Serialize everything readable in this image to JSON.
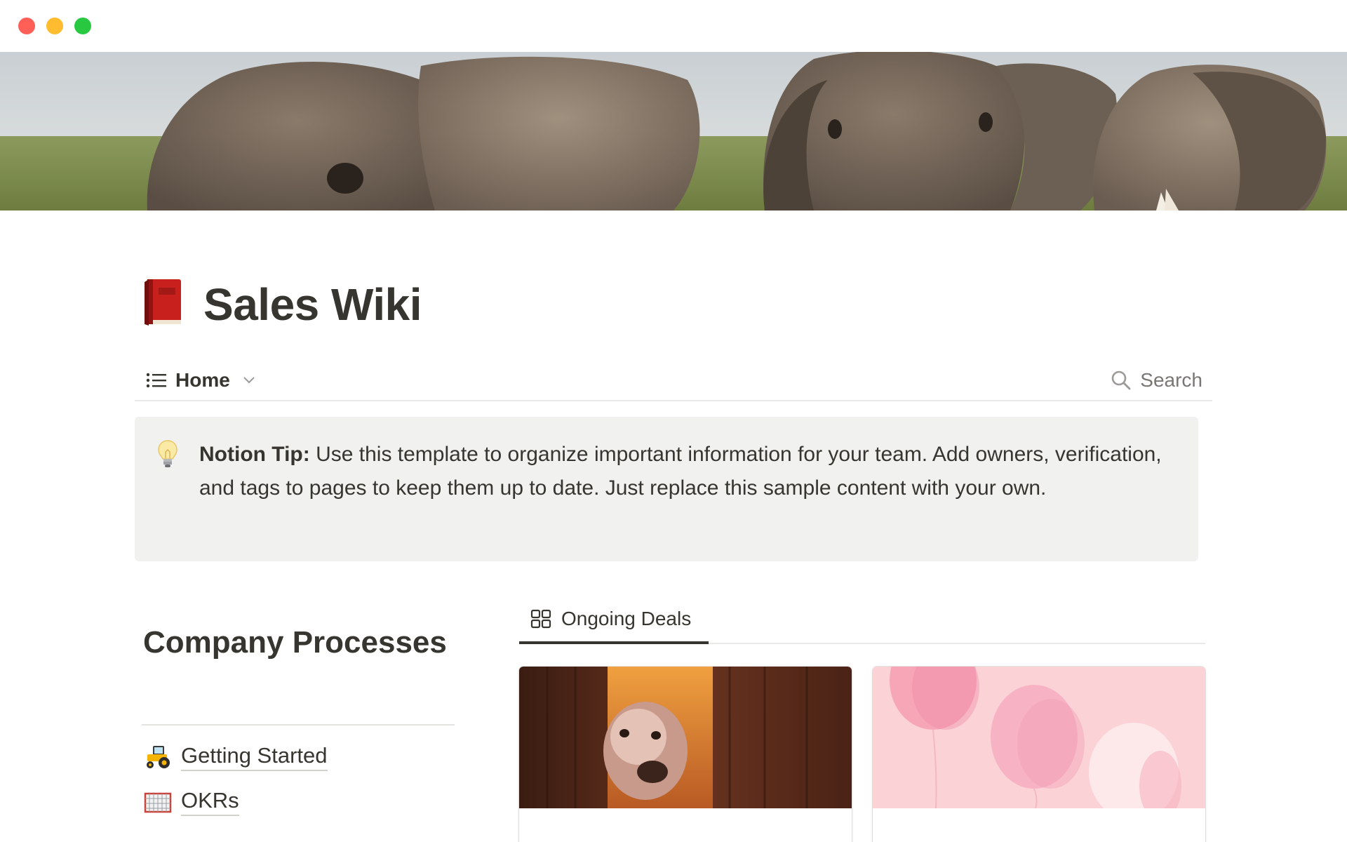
{
  "window": {
    "controls": [
      "close",
      "minimize",
      "zoom"
    ]
  },
  "cover": {
    "image": "elephants-cover-image"
  },
  "page": {
    "icon": "red-book-icon",
    "title": "Sales Wiki"
  },
  "view_bar": {
    "view_icon": "list-icon",
    "view_label": "Home",
    "dropdown_icon": "chevron-down-icon",
    "search_icon": "search-icon",
    "search_label": "Search"
  },
  "callout": {
    "icon": "lightbulb-icon",
    "label": "Notion Tip:",
    "text": "Use this template to organize important information for your team. Add owners, verification, and tags to pages to keep them up to date. Just replace this sample content with your own."
  },
  "company_processes": {
    "heading": "Company Processes",
    "items": [
      {
        "icon": "tractor-icon",
        "label": "Getting Started"
      },
      {
        "icon": "goal-net-icon",
        "label": "OKRs"
      }
    ]
  },
  "deals": {
    "tabs": [
      {
        "icon": "gallery-icon",
        "label": "Ongoing Deals"
      }
    ],
    "cards": [
      {
        "cover": "dog-peeking-image"
      },
      {
        "cover": "pink-balloons-image"
      }
    ]
  },
  "colors": {
    "text": "#37352f",
    "muted": "#787774",
    "callout_bg": "#f1f1ef",
    "divider": "#e9e9e7",
    "close": "#fe5f57",
    "minimize": "#febc2e",
    "zoom": "#28c840"
  }
}
